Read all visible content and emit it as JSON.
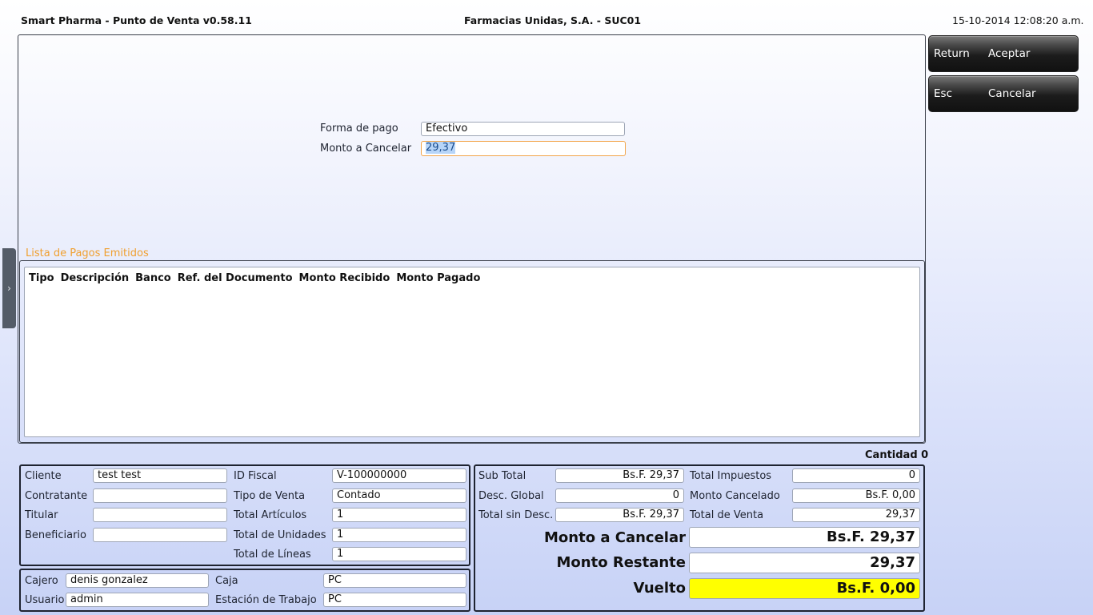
{
  "header": {
    "app_title": "Smart Pharma - Punto de Venta  v0.58.11",
    "company": "Farmacias Unidas, S.A.   -   SUC01",
    "datetime": "15-10-2014 12:08:20 a.m."
  },
  "buttons": {
    "accept": {
      "key": "Return",
      "label": "Aceptar"
    },
    "cancel": {
      "key": "Esc",
      "label": "Cancelar"
    }
  },
  "payment_form": {
    "method_label": "Forma de pago",
    "method_value": "Efectivo",
    "amount_label": "Monto a Cancelar",
    "amount_value": "29,37"
  },
  "payments_list": {
    "title": "Lista de Pagos Emitidos",
    "columns": [
      "Tipo",
      "Descripción",
      "Banco",
      "Ref. del Documento",
      "Monto Recibido",
      "Monto Pagado"
    ],
    "count_label": "Cantidad",
    "count_value": "0"
  },
  "client_info": {
    "cliente_label": "Cliente",
    "cliente_value": "test test",
    "contratante_label": "Contratante",
    "contratante_value": "",
    "titular_label": "Titular",
    "titular_value": "",
    "beneficiario_label": "Beneficiario",
    "beneficiario_value": "",
    "id_fiscal_label": "ID Fiscal",
    "id_fiscal_value": "V-100000000",
    "tipo_venta_label": "Tipo de Venta",
    "tipo_venta_value": "Contado",
    "total_articulos_label": "Total Artículos",
    "total_articulos_value": "1",
    "total_unidades_label": "Total de Unidades",
    "total_unidades_value": "1",
    "total_lineas_label": "Total de Líneas",
    "total_lineas_value": "1"
  },
  "session_info": {
    "cajero_label": "Cajero",
    "cajero_value": "denis gonzalez",
    "usuario_label": "Usuario",
    "usuario_value": "admin",
    "caja_label": "Caja",
    "caja_value": "PC",
    "estacion_label": "Estación de Trabajo",
    "estacion_value": "PC"
  },
  "totals": {
    "sub_total_label": "Sub Total",
    "sub_total_value": "Bs.F. 29,37",
    "desc_global_label": "Desc. Global",
    "desc_global_value": "0",
    "total_sin_desc_label": "Total sin Desc.",
    "total_sin_desc_value": "Bs.F. 29,37",
    "total_impuestos_label": "Total Impuestos",
    "total_impuestos_value": "0",
    "monto_cancelado_label": "Monto Cancelado",
    "monto_cancelado_value": "Bs.F. 0,00",
    "total_venta_label": "Total de Venta",
    "total_venta_value": "29,37",
    "monto_cancelar_label": "Monto a Cancelar",
    "monto_cancelar_value": "Bs.F. 29,37",
    "monto_restante_label": "Monto Restante",
    "monto_restante_value": "29,37",
    "vuelto_label": "Vuelto",
    "vuelto_value": "Bs.F. 0,00"
  }
}
